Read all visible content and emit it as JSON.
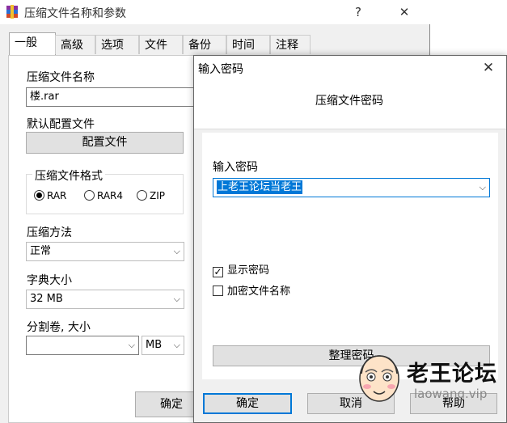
{
  "main_window": {
    "title": "压缩文件名称和参数",
    "help_glyph": "?",
    "close_glyph": "✕",
    "tabs": [
      "一般",
      "高级",
      "选项",
      "文件",
      "备份",
      "时间",
      "注释"
    ],
    "archive_name_label": "压缩文件名称",
    "archive_name_value": "楼.rar",
    "default_profile_label": "默认配置文件",
    "profile_button": "配置文件",
    "format_group_label": "压缩文件格式",
    "formats": [
      "RAR",
      "RAR4",
      "ZIP"
    ],
    "selected_format": "RAR",
    "method_label": "压缩方法",
    "method_value": "正常",
    "dict_label": "字典大小",
    "dict_value": "32 MB",
    "split_label": "分割卷, 大小",
    "split_value": "",
    "split_unit": "MB",
    "ok_button": "确定"
  },
  "password_dialog": {
    "title": "输入密码",
    "close_glyph": "✕",
    "heading": "压缩文件密码",
    "password_label": "输入密码",
    "password_value": "上老王论坛当老王",
    "show_password_label": "显示密码",
    "show_password_checked": true,
    "encrypt_names_label": "加密文件名称",
    "encrypt_names_checked": false,
    "organize_button": "整理密码",
    "ok_button": "确定",
    "cancel_button": "取消",
    "help_button": "帮助"
  },
  "watermark": {
    "text": "老王论坛",
    "url": "laowang.vip"
  },
  "colors": {
    "selection": "#0078d7",
    "button_face": "#e1e1e1",
    "window_bg": "#f0f0f0"
  }
}
